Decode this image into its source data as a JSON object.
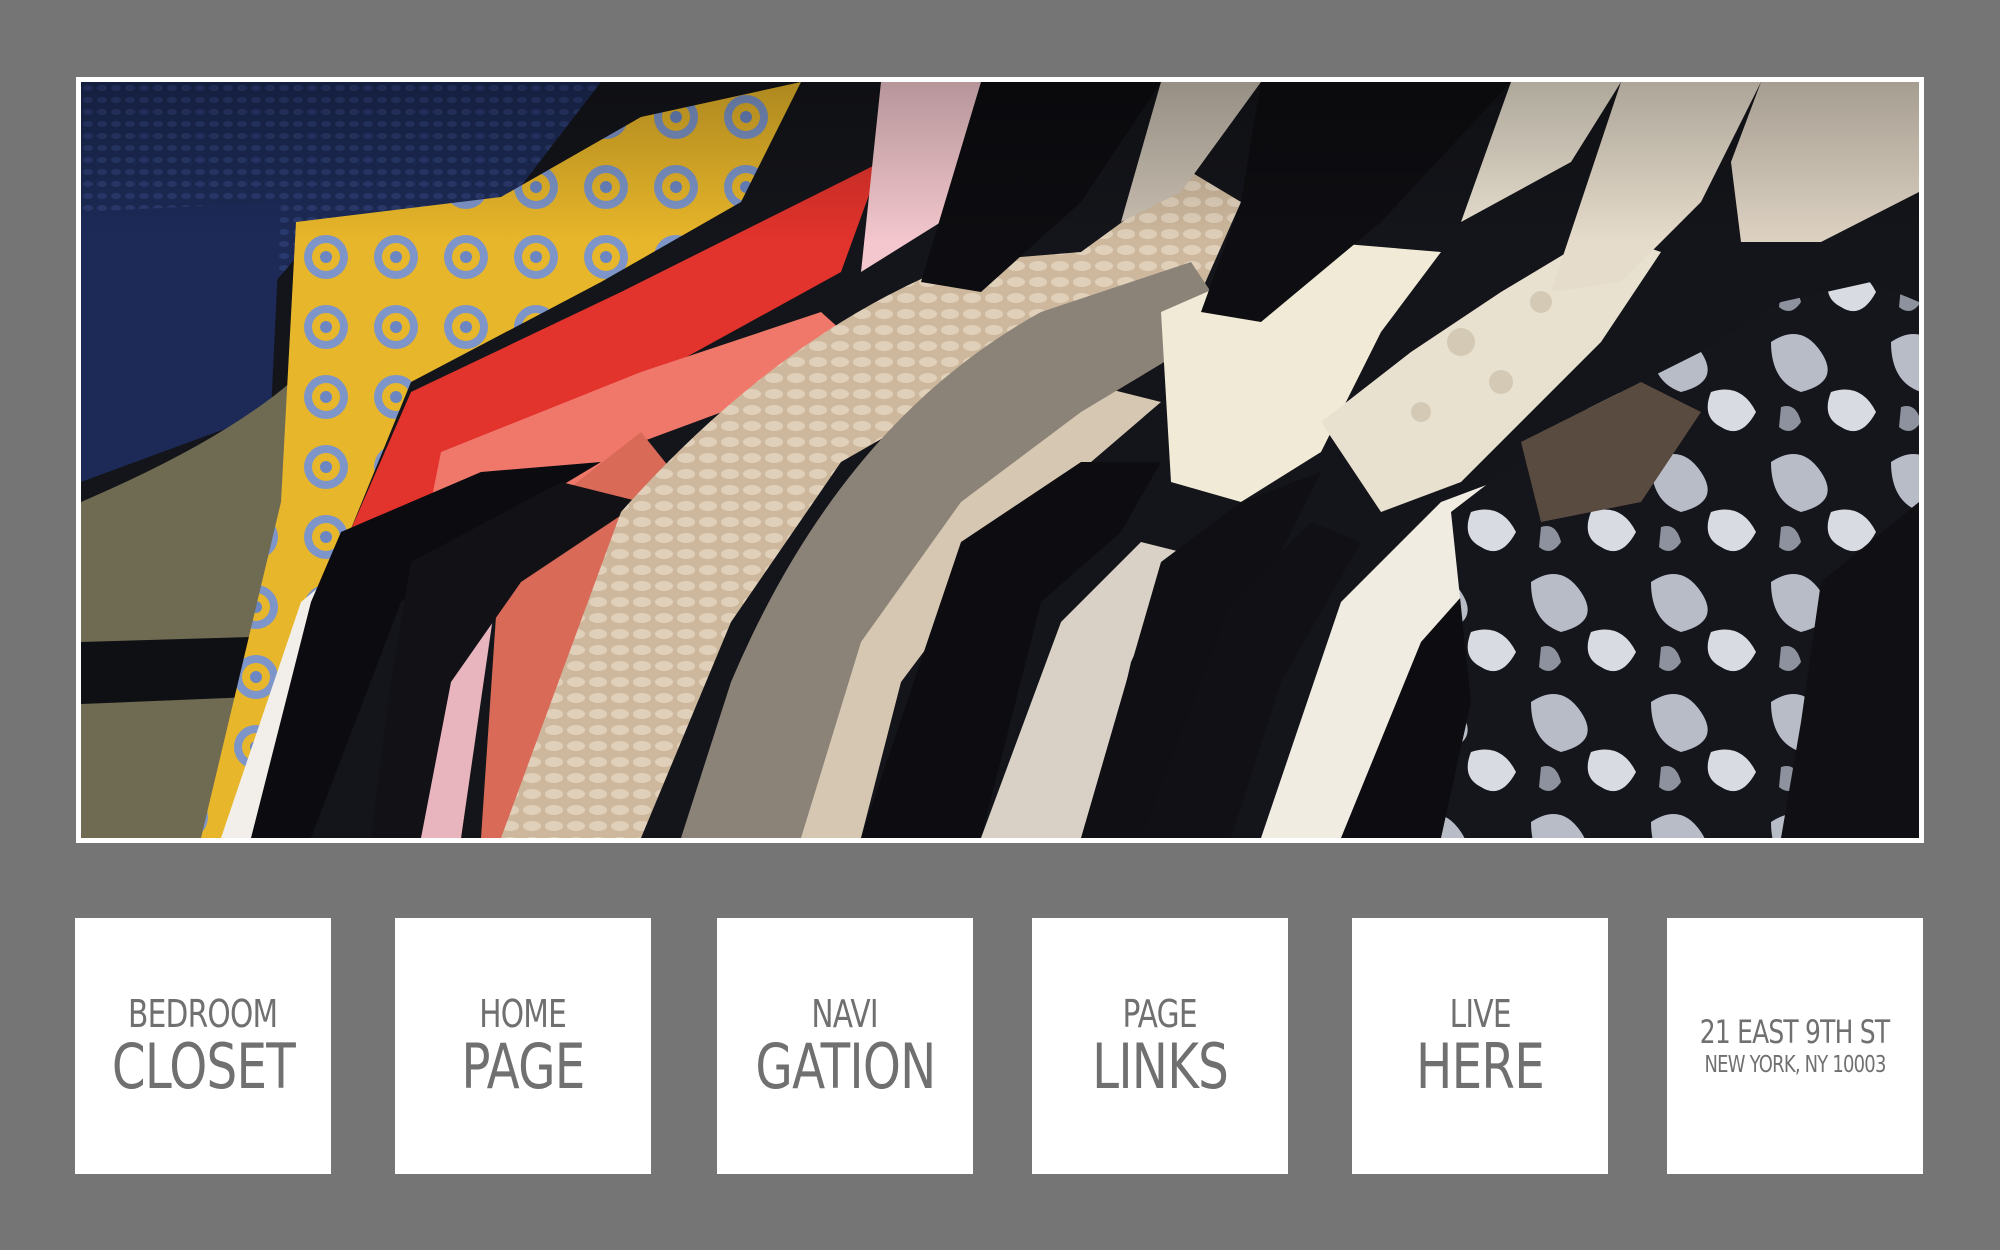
{
  "hero": {
    "image_name": "clothes-rack-photo"
  },
  "tiles": [
    {
      "line1": "BEDROOM",
      "line2": "CLOSET"
    },
    {
      "line1": "HOME",
      "line2": "PAGE"
    },
    {
      "line1": "NAVI",
      "line2": "GATION"
    },
    {
      "line1": "PAGE",
      "line2": "LINKS"
    },
    {
      "line1": "LIVE",
      "line2": "HERE"
    }
  ],
  "address": {
    "street": "21 EAST 9TH ST",
    "city": "NEW YORK, NY 10003"
  },
  "colors": {
    "background": "#747574",
    "tile": "#ffffff",
    "tile_text": "#6f706f"
  }
}
